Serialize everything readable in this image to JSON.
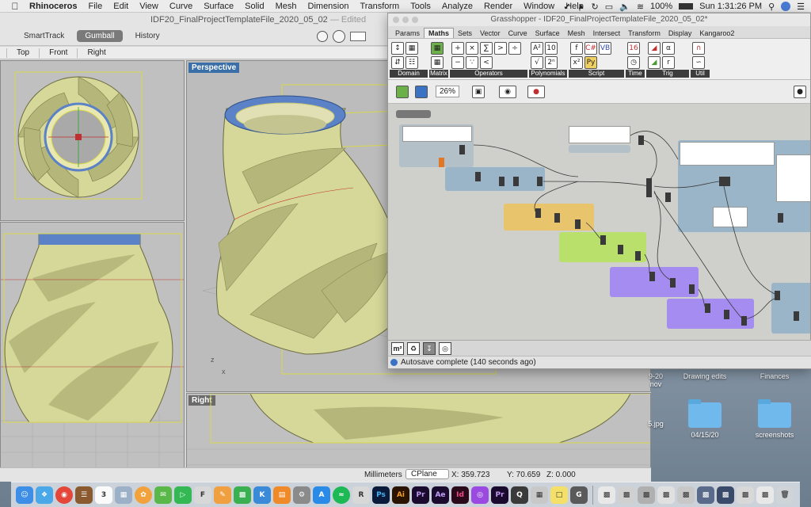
{
  "menubar": {
    "app": "Rhinoceros",
    "items": [
      "File",
      "Edit",
      "View",
      "Curve",
      "Surface",
      "Solid",
      "Mesh",
      "Dimension",
      "Transform",
      "Tools",
      "Analyze",
      "Render",
      "Window",
      "Help"
    ],
    "battery": "100%",
    "clock": "Sun 1:31:26 PM"
  },
  "rhino": {
    "title": "IDF20_FinalProjectTemplateFile_2020_05_02",
    "edited": "— Edited",
    "toolbar": {
      "smarttrack": "SmartTrack",
      "gumball": "Gumball",
      "history": "History"
    },
    "view_tabs": [
      "Top",
      "Front",
      "Right"
    ],
    "viewports": {
      "perspective": "Perspective",
      "right": "Right"
    },
    "status": {
      "units": "Millimeters",
      "cplane": "CPlane",
      "x": "X: 359.723",
      "y": "Y: 70.659",
      "z": "Z: 0.000"
    }
  },
  "grasshopper": {
    "title": "Grasshopper - IDF20_FinalProjectTemplateFile_2020_05_02*",
    "tabs": [
      "Params",
      "Maths",
      "Sets",
      "Vector",
      "Curve",
      "Surface",
      "Mesh",
      "Intersect",
      "Transform",
      "Display",
      "Kangaroo2"
    ],
    "active_tab": "Maths",
    "ribbon_groups": [
      "Domain",
      "Matrix",
      "Operators",
      "Polynomials",
      "Script",
      "Time",
      "Trig",
      "Util"
    ],
    "zoom": "26%",
    "status": "Autosave complete (140 seconds ago)"
  },
  "desktop": {
    "labels": {
      "drawing_edits": "Drawing edits",
      "finances": "Finances",
      "date_folder": "04/15/20",
      "screenshots": "screenshots",
      "partial_file": "5.jpg",
      "partial_label": "9-20",
      "partial_sub": "nov"
    }
  },
  "colors": {
    "vase": "#d6d89a",
    "rim": "#5b82c6",
    "gh_orange": "#e8c46c",
    "gh_green": "#b8e06a",
    "gh_purple": "#a58cf0",
    "gh_blue": "#9ab4c8"
  }
}
